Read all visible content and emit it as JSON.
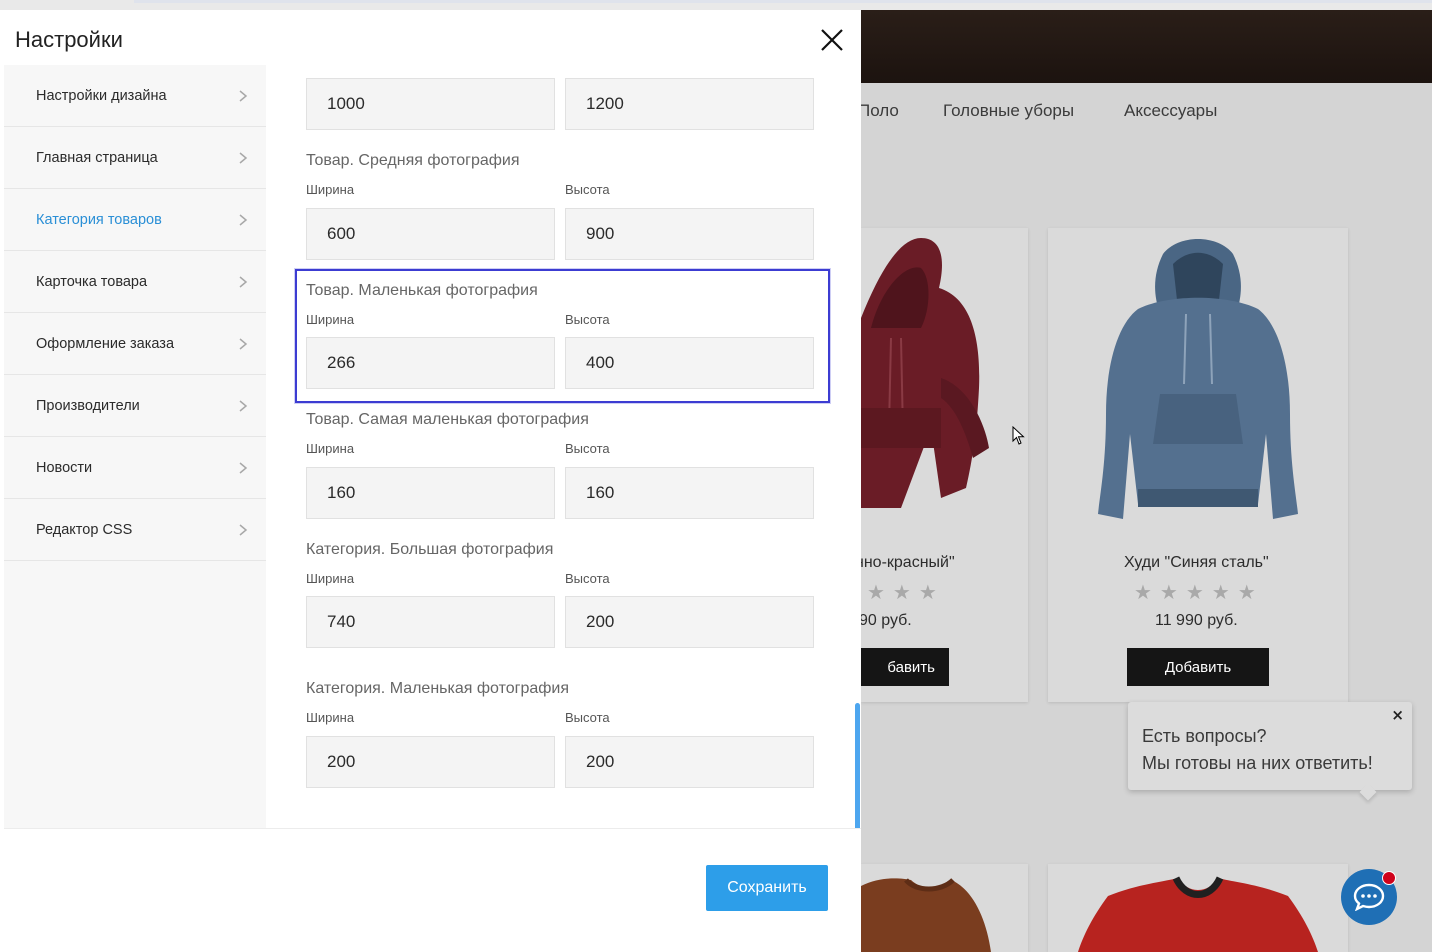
{
  "modal": {
    "title": "Настройки",
    "save_label": "Сохранить"
  },
  "sidebar": {
    "items": [
      {
        "label": "Настройки дизайна",
        "active": false
      },
      {
        "label": "Главная страница",
        "active": false
      },
      {
        "label": "Категория товаров",
        "active": true
      },
      {
        "label": "Карточка товара",
        "active": false
      },
      {
        "label": "Оформление заказа",
        "active": false
      },
      {
        "label": "Производители",
        "active": false
      },
      {
        "label": "Новости",
        "active": false
      },
      {
        "label": "Редактор CSS",
        "active": false
      }
    ]
  },
  "settings": {
    "width_label": "Ширина",
    "height_label": "Высота",
    "top_row": {
      "width": "1000",
      "height": "1200"
    },
    "groups": [
      {
        "title": "Товар. Средняя фотография",
        "width": "600",
        "height": "900"
      },
      {
        "title": "Товар. Маленькая фотография",
        "width": "266",
        "height": "400"
      },
      {
        "title": "Товар. Самая маленькая фотография",
        "width": "160",
        "height": "160"
      },
      {
        "title": "Категория. Большая фотография",
        "width": "740",
        "height": "200"
      },
      {
        "title": "Категория. Маленькая фотография",
        "width": "200",
        "height": "200"
      }
    ]
  },
  "store": {
    "nav": [
      "Поло",
      "Головные уборы",
      "Аксессуары"
    ],
    "products": [
      {
        "title": "нно-красный\"",
        "price": "90 руб.",
        "button": "бавить",
        "rating": "★★★"
      },
      {
        "title": "Худи \"Синяя сталь\"",
        "price": "11 990 руб.",
        "button": "Добавить",
        "rating": "★★★★★"
      }
    ],
    "chat": {
      "line1": "Есть вопросы?",
      "line2": "Мы готовы на них ответить!",
      "close": "×"
    }
  },
  "colors": {
    "accent": "#2d9ee9",
    "active_link": "#2a8fd6",
    "highlight": "#3c3cd2"
  }
}
